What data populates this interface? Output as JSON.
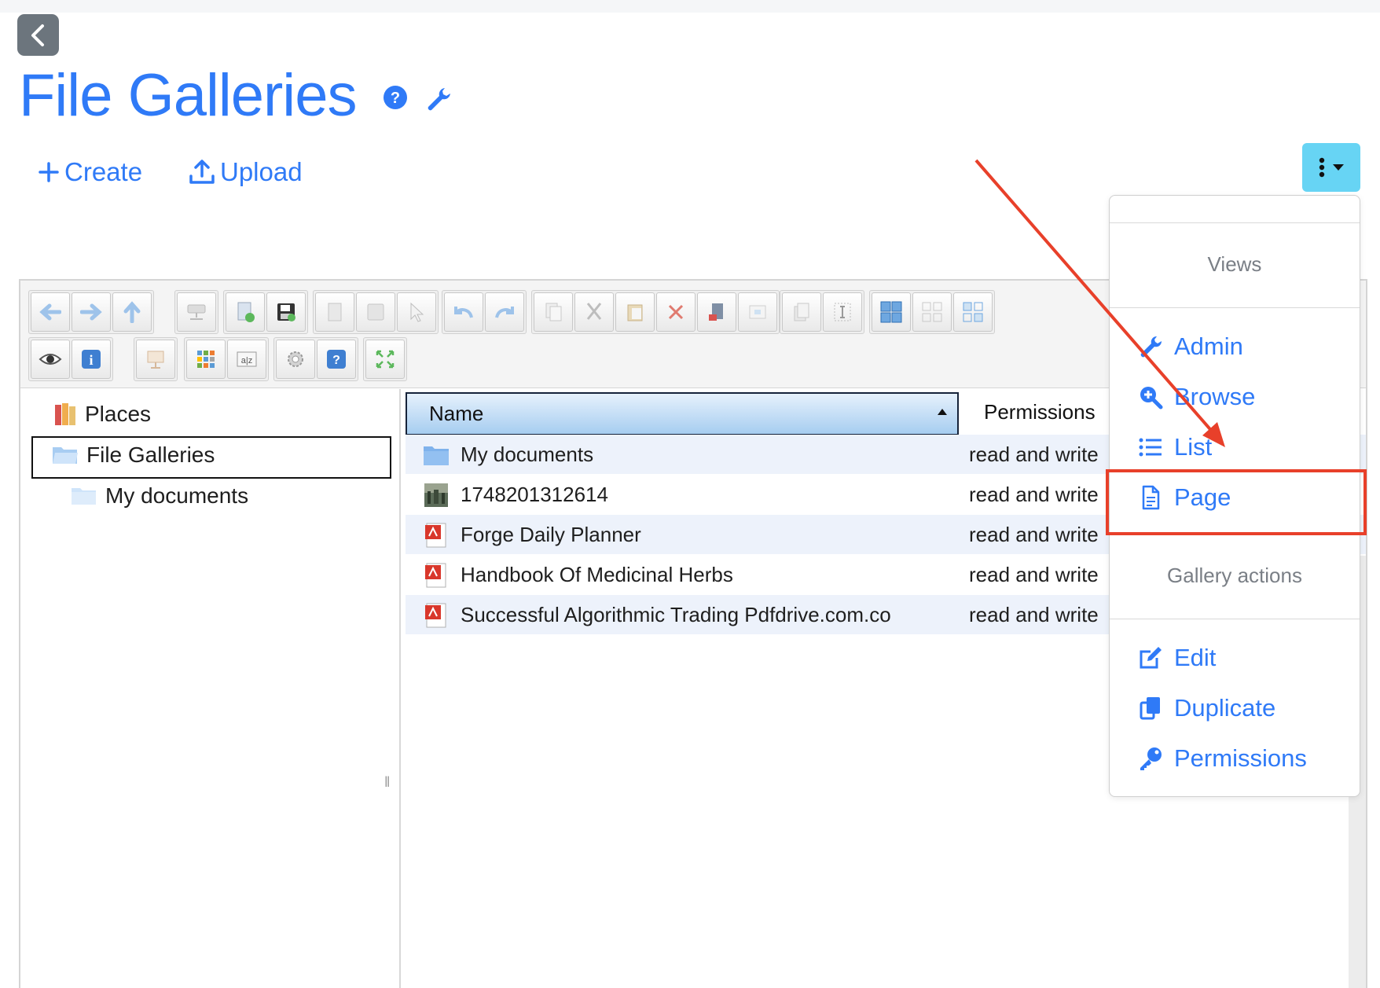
{
  "header": {
    "title": "File Galleries",
    "create_label": "Create",
    "upload_label": "Upload"
  },
  "tree": {
    "items": [
      {
        "label": "Places"
      },
      {
        "label": "File Galleries"
      },
      {
        "label": "My documents"
      }
    ]
  },
  "list": {
    "columns": {
      "name": "Name",
      "permissions": "Permissions"
    },
    "rows": [
      {
        "name": "My documents",
        "permissions": "read and write",
        "icon": "folder-icon"
      },
      {
        "name": "1748201312614",
        "permissions": "read and write",
        "icon": "image-thumbnail-icon"
      },
      {
        "name": "Forge Daily Planner",
        "permissions": "read and write",
        "icon": "pdf-icon"
      },
      {
        "name": "Handbook Of Medicinal Herbs",
        "permissions": "read and write",
        "icon": "pdf-icon"
      },
      {
        "name": "Successful Algorithmic Trading Pdfdrive.com.co",
        "permissions": "read and write",
        "icon": "pdf-icon"
      }
    ]
  },
  "menu": {
    "views_header": "Views",
    "views": [
      {
        "label": "Admin",
        "icon": "wrench-icon"
      },
      {
        "label": "Browse",
        "icon": "zoom-icon"
      },
      {
        "label": "List",
        "icon": "list-icon"
      },
      {
        "label": "Page",
        "icon": "file-icon"
      }
    ],
    "actions_header": "Gallery actions",
    "actions": [
      {
        "label": "Edit",
        "icon": "edit-icon"
      },
      {
        "label": "Duplicate",
        "icon": "copy-icon"
      },
      {
        "label": "Permissions",
        "icon": "key-icon"
      }
    ]
  },
  "colors": {
    "accent": "#2f7af7",
    "menu_button": "#67d4f4",
    "annotation": "#e8402a"
  }
}
